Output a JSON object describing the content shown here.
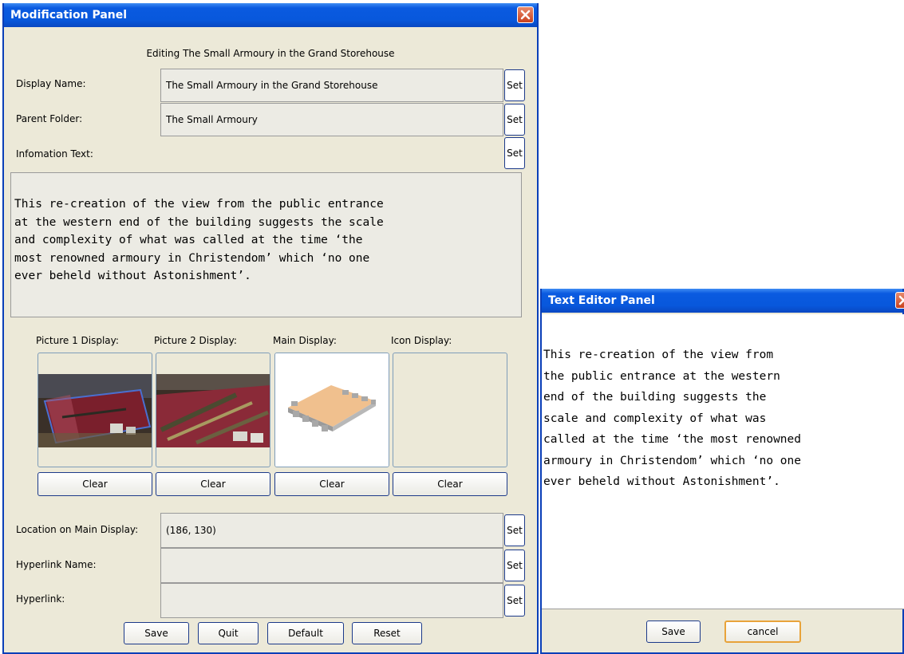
{
  "mod_panel": {
    "title": "Modification Panel",
    "heading": "Editing The Small Armoury in the Grand Storehouse",
    "display_name_label": "Display Name:",
    "display_name_value": "The Small Armoury in the Grand Storehouse",
    "parent_folder_label": "Parent Folder:",
    "parent_folder_value": "The Small Armoury",
    "info_text_label": "Infomation Text:",
    "info_text_lines": [
      "This re-creation of the view from the public entrance",
      "at the western end of the building suggests the scale",
      "and complexity of what was called at the time ‘the",
      "most renowned armoury in Christendom’ which ‘no one",
      "ever beheld without Astonishment’."
    ],
    "set_label": "Set",
    "displays": [
      {
        "label": "Picture 1 Display:",
        "clear": "Clear"
      },
      {
        "label": "Picture 2 Display:",
        "clear": "Clear"
      },
      {
        "label": "Main Display:",
        "clear": "Clear"
      },
      {
        "label": "Icon Display:",
        "clear": "Clear"
      }
    ],
    "location_label": "Location on Main Display:",
    "location_value": "(186, 130)",
    "hyperlink_name_label": "Hyperlink Name:",
    "hyperlink_name_value": "",
    "hyperlink_label": "Hyperlink:",
    "hyperlink_value": "",
    "buttons": {
      "save": "Save",
      "quit": "Quit",
      "default": "Default",
      "reset": "Reset"
    }
  },
  "text_editor": {
    "title": "Text Editor Panel",
    "lines": [
      "This re-creation of the view from",
      "the public entrance at the western",
      "end of the building suggests the",
      "scale and complexity of what was",
      "called at the time ‘the most renowned",
      "armoury in Christendom’ which ‘no one",
      "ever beheld without Astonishment’."
    ],
    "save": "Save",
    "cancel": "cancel"
  },
  "colors": {
    "titlebar": "#0858dc",
    "window_bg": "#ece9d8",
    "close": "#c9401d"
  },
  "icons": {
    "close": "close-icon"
  }
}
